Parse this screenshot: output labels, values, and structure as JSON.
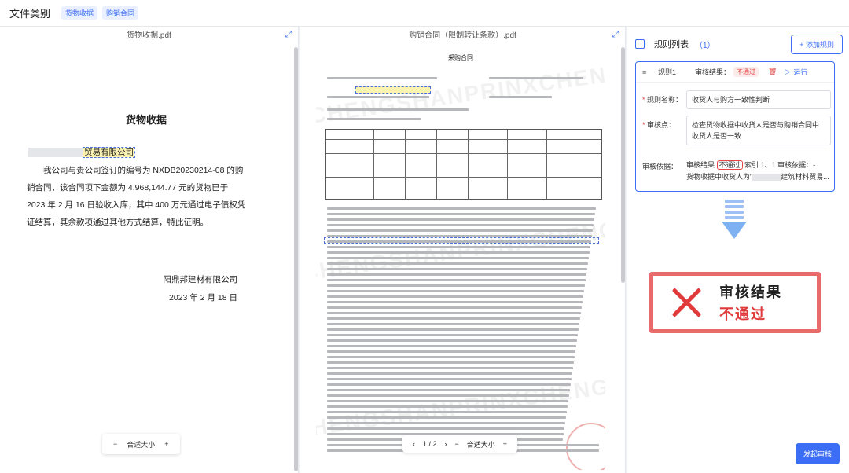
{
  "topbar": {
    "title": "文件类别",
    "chips": [
      "货物收据",
      "购销合同"
    ]
  },
  "left_panel": {
    "filename": "货物收据.pdf",
    "doc": {
      "title": "货物收据",
      "recipient_suffix": "贸易有限公司",
      "body": "我公司与贵公司签订的编号为 NXDB20230214-08 的购销合同，该合同项下金额为 4,968,144.77 元的货物已于 2023 年 2 月 16 日验收入库，其中 400 万元通过电子债权凭证结算，其余款项通过其他方式结算，特此证明。",
      "sign_company": "阳鼎邦建材有限公司",
      "sign_date": "2023 年 2 月 18 日"
    },
    "zoom": {
      "minus": "−",
      "label": "合适大小",
      "plus": "+"
    }
  },
  "mid_panel": {
    "filename": "购销合同（限制转让条款）.pdf",
    "contract_title": "采购合同",
    "watermark": "CHENGSHANPRINXCHENGSHAN",
    "pager": {
      "prev": "‹",
      "page": "1 / 2",
      "next": "›",
      "minus": "−",
      "label": "合适大小",
      "plus": "+"
    }
  },
  "right_panel": {
    "title": "规则列表",
    "count": "（1）",
    "add_button": "+ 添加规则",
    "rule": {
      "name": "规则1",
      "result_label": "审核结果：",
      "result_badge": "不通过",
      "run_label": "运行",
      "rule_name_label": "规则名称：",
      "rule_name_value": "收货人与购方一致性判断",
      "audit_point_label": "审核点：",
      "audit_point_value": "检查货物收据中收货人是否与购销合同中收货人是否一致",
      "basis_label": "审核依据：",
      "basis_prefix": "审核结果",
      "basis_badge": "不通过",
      "basis_text1": "索引 1、1 审核依据：-",
      "basis_text2": "货物收据中收货人为\"",
      "basis_text3": "建筑材料贸易..."
    },
    "result": {
      "line1": "审核结果",
      "line2": "不通过"
    },
    "submit_button": "发起审核"
  },
  "colors": {
    "accent": "#3b6ef5",
    "danger": "#e03a3a",
    "highlight": "#fdf3b0"
  }
}
